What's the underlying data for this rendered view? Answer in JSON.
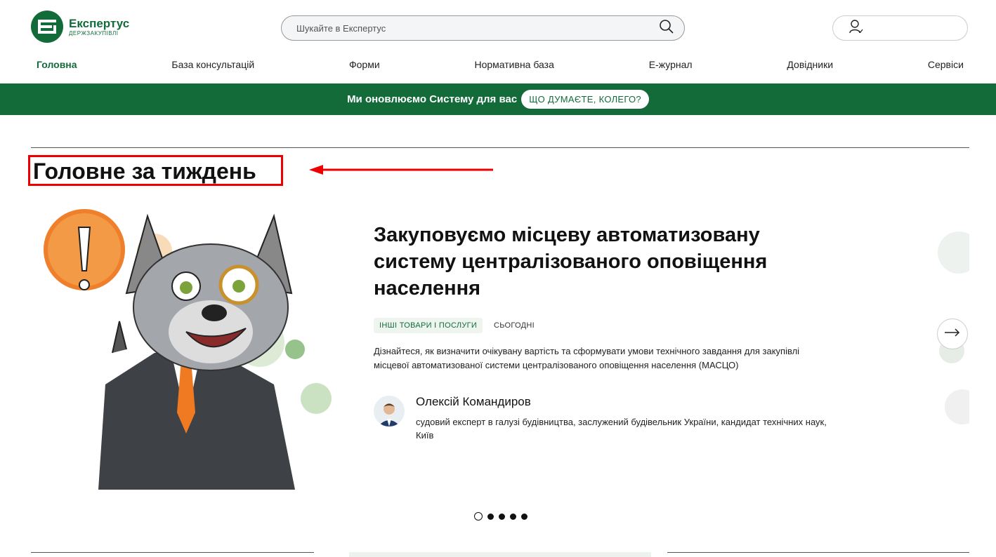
{
  "brand": {
    "name": "Експертус",
    "sub": "ДЕРЖЗАКУПІВЛІ",
    "color": "#146b3a"
  },
  "search": {
    "placeholder": "Шукайте в Експертус",
    "icon": "search-icon"
  },
  "user": {
    "icon": "user-icon"
  },
  "nav": [
    {
      "label": "Головна",
      "active": true
    },
    {
      "label": "База консультацій"
    },
    {
      "label": "Форми"
    },
    {
      "label": "Нормативна база"
    },
    {
      "label": "Е-журнал"
    },
    {
      "label": "Довідники"
    },
    {
      "label": "Сервіси"
    }
  ],
  "banner": {
    "text": "Ми оновлюємо Систему для вас",
    "button": "ЩО ДУМАЄТЕ, КОЛЕГО?"
  },
  "section": {
    "title": "Головне за тиждень"
  },
  "slide": {
    "title": "Закуповуємо місцеву автоматизовану систему централізованого оповіщення населення",
    "tag": "ІНШІ ТОВАРИ І ПОСЛУГИ",
    "date": "СЬОГОДНІ",
    "description": "Дізнайтеся, як визначити очікувану вартість та сформувати умови технічного завдання для закупівлі місцевої автоматизованої системи централізованого оповіщення населення (МАСЦО)",
    "author": {
      "name": "Олексій Командиров",
      "bio": "судовий експерт в галузі будівництва, заслужений будівельник України, кандидат технічних наук, Київ"
    }
  },
  "carousel": {
    "current": 1,
    "total": 5,
    "next_icon": "arrow-right-icon"
  },
  "colors": {
    "accent": "#146b3a",
    "highlight": "#e00000"
  }
}
